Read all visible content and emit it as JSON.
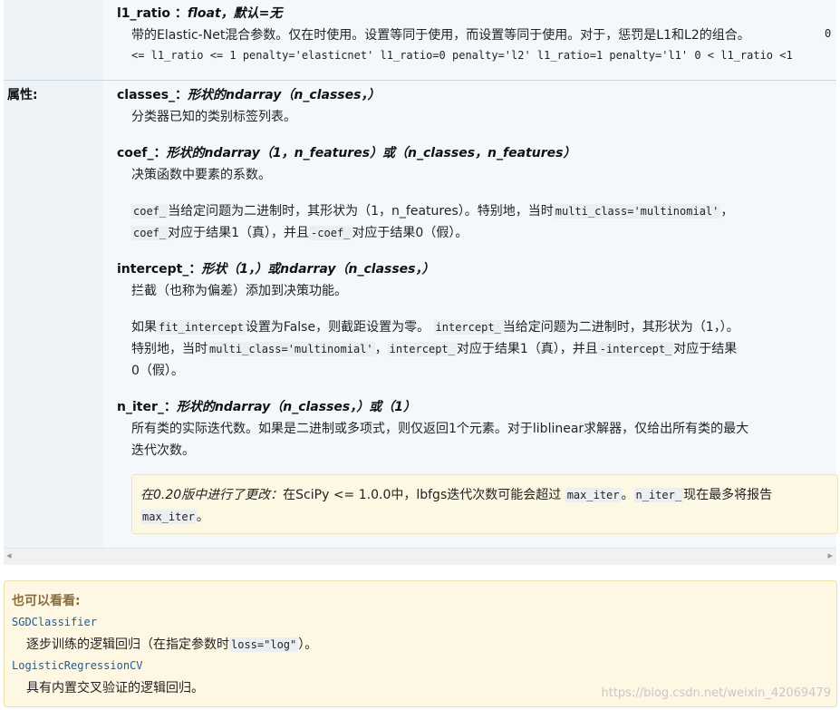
{
  "l1_ratio": {
    "name": "l1_ratio",
    "sep": "：",
    "type": "float，默认=无",
    "desc_prefix": "带的Elastic-Net混合参数。仅在时使用。设置等同于使用，而设置等同于使用。对于，惩罚是L1和L2的组合。",
    "desc_end": "0",
    "code_line": "<= l1_ratio <= 1 penalty='elasticnet' l1_ratio=0 penalty='l2' l1_ratio=1 penalty='l1' 0 < l1_ratio <1"
  },
  "attributes_label": "属性:",
  "classes": {
    "name": "classes_",
    "sep": "：",
    "type": "形状的ndarray（n_classes，）",
    "desc": "分类器已知的类别标签列表。"
  },
  "coef": {
    "name": "coef_",
    "sep": "：",
    "type": "形状的ndarray（1，n_features）或（n_classes，n_features）",
    "desc": "决策函数中要素的系数。",
    "p1": {
      "code1": "coef_",
      "t1": "当给定问题为二进制时，其形状为（1，n_features）。特别地，当时",
      "code2": "multi_class='multinomial'",
      "t2": "，"
    },
    "p2": {
      "code1": "coef_",
      "t1": "对应于结果1（真），并且",
      "code2": "-coef_",
      "t2": "对应于结果0（假）。"
    }
  },
  "intercept": {
    "name": "intercept_",
    "sep": "：",
    "type": "形状（1，）或ndarray（n_classes，）",
    "desc": "拦截（也称为偏差）添加到决策功能。",
    "p1": {
      "t0": "如果",
      "code1": "fit_intercept",
      "t1": "设置为False，则截距设置为零。",
      "code2": "intercept_",
      "t2": "当给定问题为二进制时，其形状为（1，）。"
    },
    "p2": {
      "t0": "特别地，当时",
      "code1": "multi_class='multinomial'",
      "t1": "，",
      "code2": "intercept_",
      "t2": "对应于结果1（真），并且",
      "code3": "-intercept_",
      "t3": "对应于结果"
    },
    "p3": "0（假）。"
  },
  "n_iter": {
    "name": "n_iter_",
    "sep": "：",
    "type": "形状的ndarray（n_classes，）或（1）",
    "desc1": "所有类的实际迭代数。如果是二进制或多项式，则仅返回1个元素。对于liblinear求解器，仅给出所有类的最大",
    "desc2": "迭代次数。"
  },
  "versionchanged": {
    "label": "在0.20版中进行了更改：",
    "t1": "在SciPy <= 1.0.0中，lbfgs迭代次数可能会超过",
    "code1": "max_iter",
    "t2": "。",
    "code2": "n_iter_",
    "t3": "现在最多将报告",
    "code3": "max_iter",
    "t4": "。"
  },
  "scroll": {
    "left_arrow": "◂",
    "right_arrow": "▸"
  },
  "seealso": {
    "title": "也可以看看:",
    "items": [
      {
        "link": "SGDClassifier",
        "desc_prefix": "逐步训练的逻辑回归（在指定参数时",
        "code": "loss=\"log\"",
        "desc_suffix": "）。"
      },
      {
        "link": "LogisticRegressionCV",
        "desc": "具有内置交叉验证的逻辑回归。"
      }
    ]
  },
  "watermark": "https://blog.csdn.net/weixin_42069479"
}
